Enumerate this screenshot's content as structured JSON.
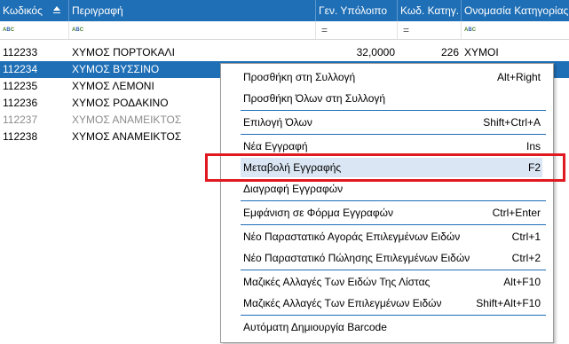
{
  "grid": {
    "columns": [
      "Κωδικός",
      "Περιγραφή",
      "Γεν. Υπόλοιπο",
      "Κωδ. Κατηγ.",
      "Ονομασία Κατηγορίας"
    ],
    "rows": [
      {
        "code": "112233",
        "desc": "ΧΥΜΟΣ ΠΟΡΤΟΚΑΛΙ",
        "balance": "32,0000",
        "cat_code": "226",
        "cat_name": "ΧΥΜΟΙ"
      },
      {
        "code": "112234",
        "desc": "ΧΥΜΟΣ ΒΥΣΣΙΝΟ"
      },
      {
        "code": "112235",
        "desc": "ΧΥΜΟΣ ΛΕΜΟΝΙ"
      },
      {
        "code": "112236",
        "desc": "ΧΥΜΟΣ ΡΟΔΑΚΙΝΟ"
      },
      {
        "code": "112237",
        "desc": "ΧΥΜΟΣ ΑΝΑΜΕΙΚΤΟΣ"
      },
      {
        "code": "112238",
        "desc": "ΧΥΜΟΣ ΑΝΑΜΕΙΚΤΟΣ"
      }
    ],
    "filter_icons": [
      "abc-filter-icon",
      "abc-filter-icon",
      "equals-filter-icon",
      "equals-filter-icon",
      "abc-filter-icon"
    ]
  },
  "menu": {
    "items": [
      {
        "label": "Προσθήκη στη Συλλογή",
        "shortcut": "Alt+Right"
      },
      {
        "label": "Προσθήκη Όλων στη Συλλογή",
        "shortcut": ""
      },
      {
        "label": "Επιλογή Όλων",
        "shortcut": "Shift+Ctrl+A"
      },
      {
        "label": "Νέα Εγγραφή",
        "shortcut": "Ins"
      },
      {
        "label": "Μεταβολή Εγγραφής",
        "shortcut": "F2"
      },
      {
        "label": "Διαγραφή Εγγραφών",
        "shortcut": ""
      },
      {
        "label": "Εμφάνιση σε Φόρμα Εγγραφών",
        "shortcut": "Ctrl+Enter"
      },
      {
        "label": "Νέο Παραστατικό Αγοράς Επιλεγμένων Ειδών",
        "shortcut": "Ctrl+1"
      },
      {
        "label": "Νέο Παραστατικό Πώλησης Επιλεγμένων Ειδών",
        "shortcut": "Ctrl+2"
      },
      {
        "label": "Μαζικές Αλλαγές Των Ειδών Της Λίστας",
        "shortcut": "Alt+F10"
      },
      {
        "label": "Μαζικές Αλλαγές Των Επιλεγμένων Ειδών",
        "shortcut": "Shift+Alt+F10"
      },
      {
        "label": "Αυτόματη Δημιουργία Barcode",
        "shortcut": ""
      }
    ]
  },
  "colors": {
    "header_bg": "#1f6fb6",
    "selection_bg": "#1f6fb6",
    "highlight_box": "#e0181f",
    "menu_hover": "#dbe6f4"
  }
}
